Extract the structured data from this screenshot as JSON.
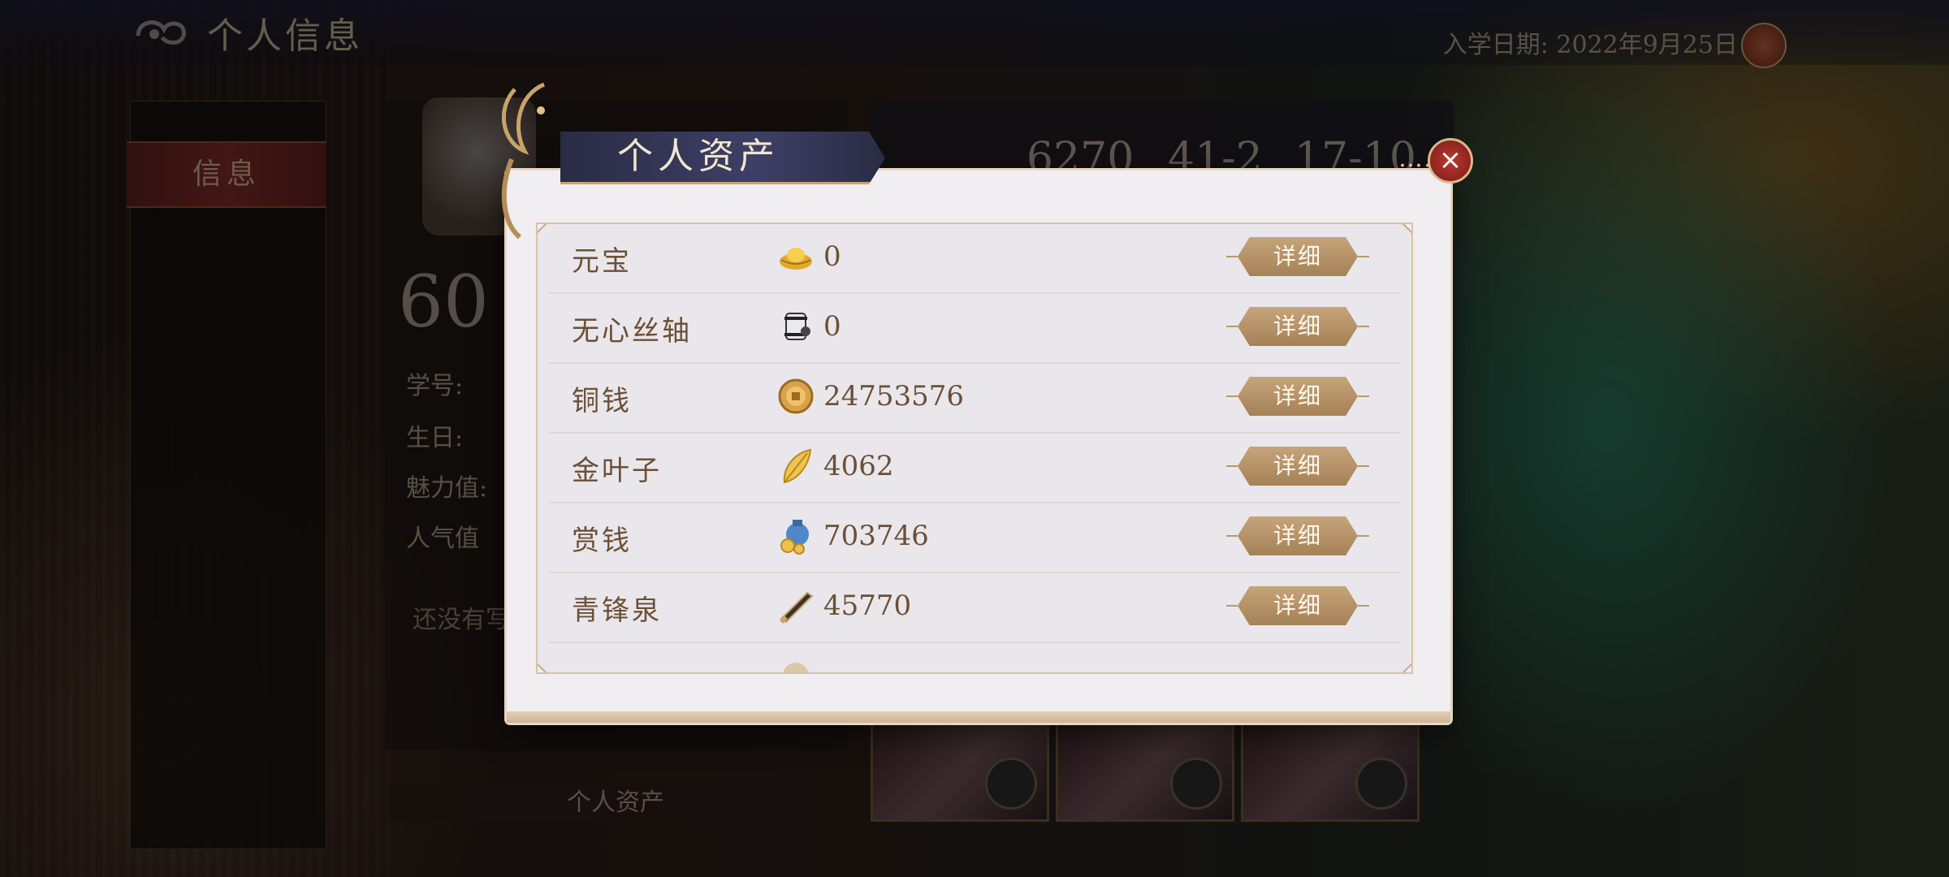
{
  "page": {
    "title": "个人信息",
    "enroll_date": "入学日期: 2022年9月25日",
    "left_tab": "信息",
    "level": "60",
    "profile_labels": [
      "学号:",
      "生日:",
      "魅力值:",
      "人气值"
    ],
    "notice": "还没有写",
    "bottom_label": "个人资产",
    "stats": [
      "6270",
      "41-2",
      "17-10"
    ]
  },
  "modal": {
    "title": "个人资产",
    "close_label": "×",
    "dots": "……",
    "detail_label": "详细",
    "assets": [
      {
        "name": "元宝",
        "value": "0",
        "icon": "gold-ingot-icon"
      },
      {
        "name": "无心丝轴",
        "value": "0",
        "icon": "silk-spool-icon"
      },
      {
        "name": "铜钱",
        "value": "24753576",
        "icon": "copper-coin-icon"
      },
      {
        "name": "金叶子",
        "value": "4062",
        "icon": "gold-leaf-icon"
      },
      {
        "name": "赏钱",
        "value": "703746",
        "icon": "money-pouch-icon"
      },
      {
        "name": "青锋泉",
        "value": "45770",
        "icon": "blade-icon"
      }
    ]
  },
  "colors": {
    "modal_bg": "#f0eef1",
    "accent_gold": "#a58156",
    "title_banner": "#3d4066",
    "close_red": "#b83a32",
    "text_brown": "#6b4f36"
  }
}
